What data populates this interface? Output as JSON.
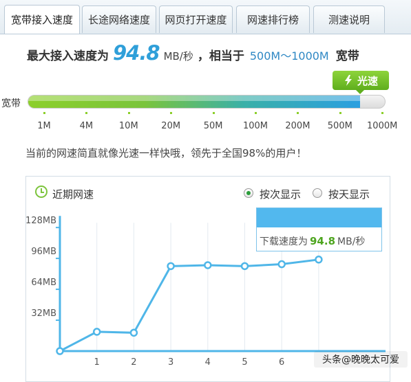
{
  "tabs": [
    {
      "label": "宽带接入速度",
      "active": true
    },
    {
      "label": "长途网络速度",
      "active": false
    },
    {
      "label": "网页打开速度",
      "active": false
    },
    {
      "label": "网速排行榜",
      "active": false
    },
    {
      "label": "测速说明",
      "active": false
    }
  ],
  "headline": {
    "prefix": "最大接入速度为",
    "speed": "94.8",
    "unit": "MB/秒",
    "equiv": "，相当于",
    "range": "500M～1000M",
    "suffix": "宽带"
  },
  "speed_bar": {
    "label": "宽带",
    "badge": "光速",
    "badge_icon": "lightning-icon",
    "fill_fraction": 0.93,
    "ticks": [
      "1M",
      "4M",
      "10M",
      "20M",
      "50M",
      "100M",
      "200M",
      "500M",
      "1000M"
    ]
  },
  "summary": "当前的网速简直就像光速一样快哦，领先于全国98%的用户！",
  "chart": {
    "title": "近期网速",
    "title_icon": "clock-icon",
    "radio_options": [
      {
        "label": "按次显示",
        "selected": true
      },
      {
        "label": "按天显示",
        "selected": false
      }
    ],
    "tooltip": {
      "prefix": "下载速度为",
      "value": "94.8",
      "unit": "MB/秒"
    }
  },
  "chart_data": {
    "type": "line",
    "x": [
      0,
      1,
      2,
      3,
      4,
      5,
      6,
      7
    ],
    "xticks": [
      "1",
      "2",
      "3",
      "4",
      "5",
      "6"
    ],
    "values": [
      0,
      20,
      19,
      88,
      89,
      88,
      90,
      94.8
    ],
    "ylim": [
      0,
      140
    ],
    "yticks": [
      32,
      64,
      96,
      128
    ],
    "ytick_labels": [
      "32MB",
      "64MB",
      "96MB",
      "128MB"
    ],
    "color": "#4fb6e8",
    "grid": true
  },
  "watermark": "头条@晚晚太可爱",
  "colors": {
    "accent": "#2f9fd9",
    "green": "#7cc43c",
    "line": "#4fb6e8"
  }
}
